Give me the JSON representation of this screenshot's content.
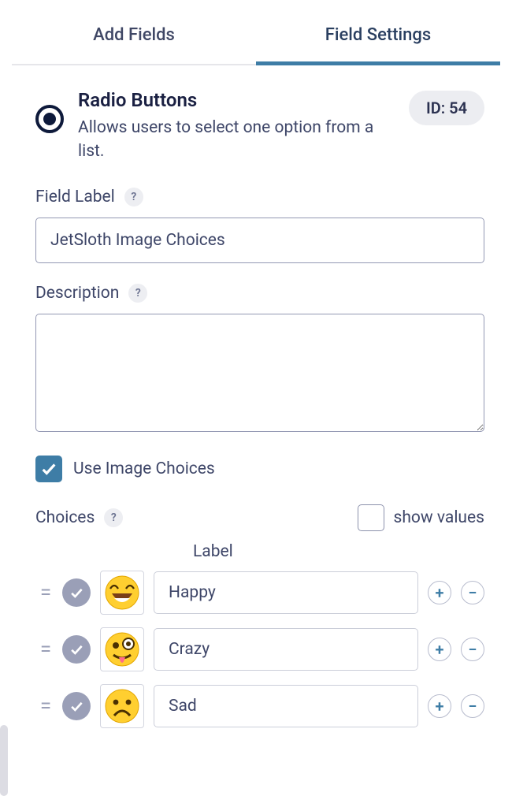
{
  "tabs": {
    "add_fields": "Add Fields",
    "field_settings": "Field Settings"
  },
  "header": {
    "title": "Radio Buttons",
    "description": "Allows users to select one option from a list.",
    "id_label": "ID: 54"
  },
  "field_label": {
    "label": "Field Label",
    "help": "?",
    "value": "JetSloth Image Choices"
  },
  "description": {
    "label": "Description",
    "help": "?",
    "value": ""
  },
  "use_image_choices": {
    "label": "Use Image Choices",
    "checked": true
  },
  "choices": {
    "label": "Choices",
    "help": "?",
    "show_values_label": "show values",
    "column_label": "Label",
    "items": [
      {
        "label": "Happy",
        "emoji": "happy"
      },
      {
        "label": "Crazy",
        "emoji": "crazy"
      },
      {
        "label": "Sad",
        "emoji": "sad"
      }
    ]
  }
}
